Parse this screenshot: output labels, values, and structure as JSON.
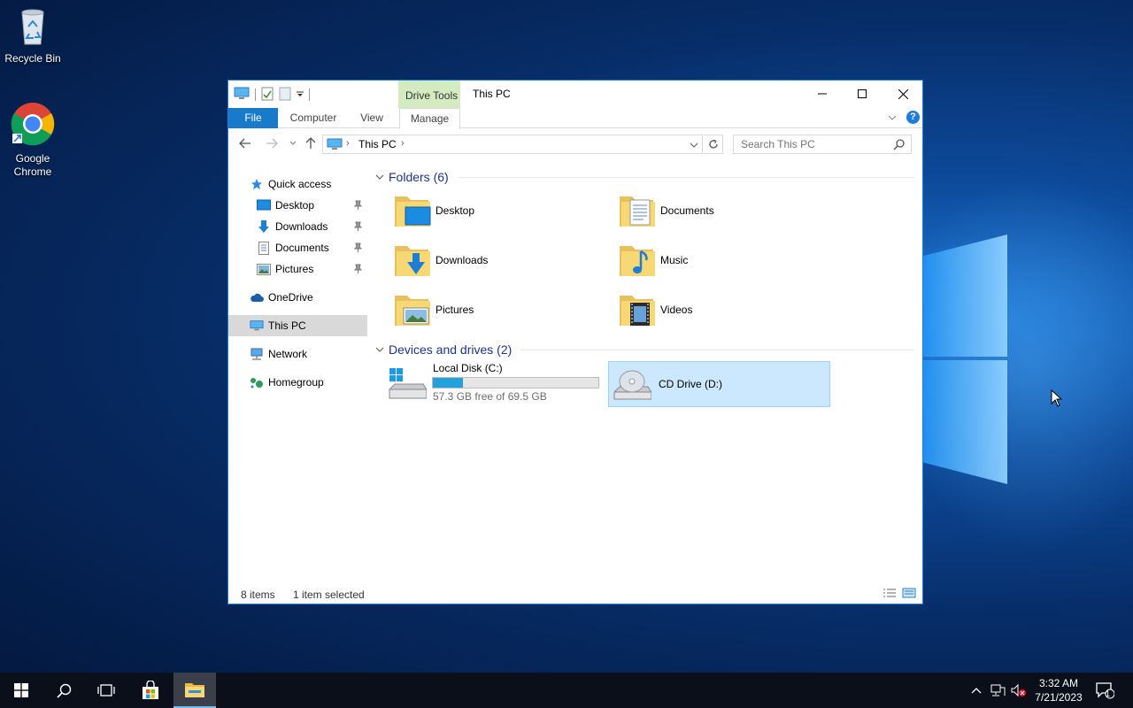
{
  "desktop": {
    "icons": [
      {
        "label": "Recycle Bin",
        "icon": "recycle-bin-icon"
      },
      {
        "label": "Google\nChrome",
        "label_line1": "Google",
        "label_line2": "Chrome",
        "icon": "chrome-icon"
      }
    ]
  },
  "window": {
    "title": "This PC",
    "contextual_tab_group": "Drive Tools",
    "ribbon_tabs": [
      "File",
      "Computer",
      "View",
      "Manage"
    ],
    "address": {
      "root_label": "This PC"
    },
    "search": {
      "placeholder": "Search This PC"
    },
    "nav_pane": {
      "items": [
        {
          "label": "Quick access",
          "icon": "star-icon"
        },
        {
          "label": "Desktop",
          "icon": "desktop-icon",
          "pinned": true
        },
        {
          "label": "Downloads",
          "icon": "download-arrow-icon",
          "pinned": true
        },
        {
          "label": "Documents",
          "icon": "document-icon",
          "pinned": true
        },
        {
          "label": "Pictures",
          "icon": "picture-icon",
          "pinned": true
        },
        {
          "label": "OneDrive",
          "icon": "cloud-icon"
        },
        {
          "label": "This PC",
          "icon": "computer-icon",
          "selected": true
        },
        {
          "label": "Network",
          "icon": "network-icon"
        },
        {
          "label": "Homegroup",
          "icon": "homegroup-icon"
        }
      ]
    },
    "folders_group": {
      "header": "Folders (6)",
      "items": [
        "Desktop",
        "Documents",
        "Downloads",
        "Music",
        "Pictures",
        "Videos"
      ]
    },
    "drives_group": {
      "header": "Devices and drives (2)",
      "drives": [
        {
          "name": "Local Disk (C:)",
          "free_text": "57.3 GB free of 69.5 GB",
          "used_fraction": 0.18,
          "icon": "hard-disk-icon"
        },
        {
          "name": "CD Drive (D:)",
          "icon": "cd-drive-icon",
          "selected": true
        }
      ]
    },
    "status": {
      "item_count": "8 items",
      "selection": "1 item selected"
    }
  },
  "taskbar": {
    "clock_time": "3:32 AM",
    "clock_date": "7/21/2023",
    "notification_count": "1"
  },
  "colors": {
    "accent": "#1979ca",
    "selection": "#cce8ff",
    "group_header": "#1e3287",
    "disk_bar": "#26a0da"
  }
}
